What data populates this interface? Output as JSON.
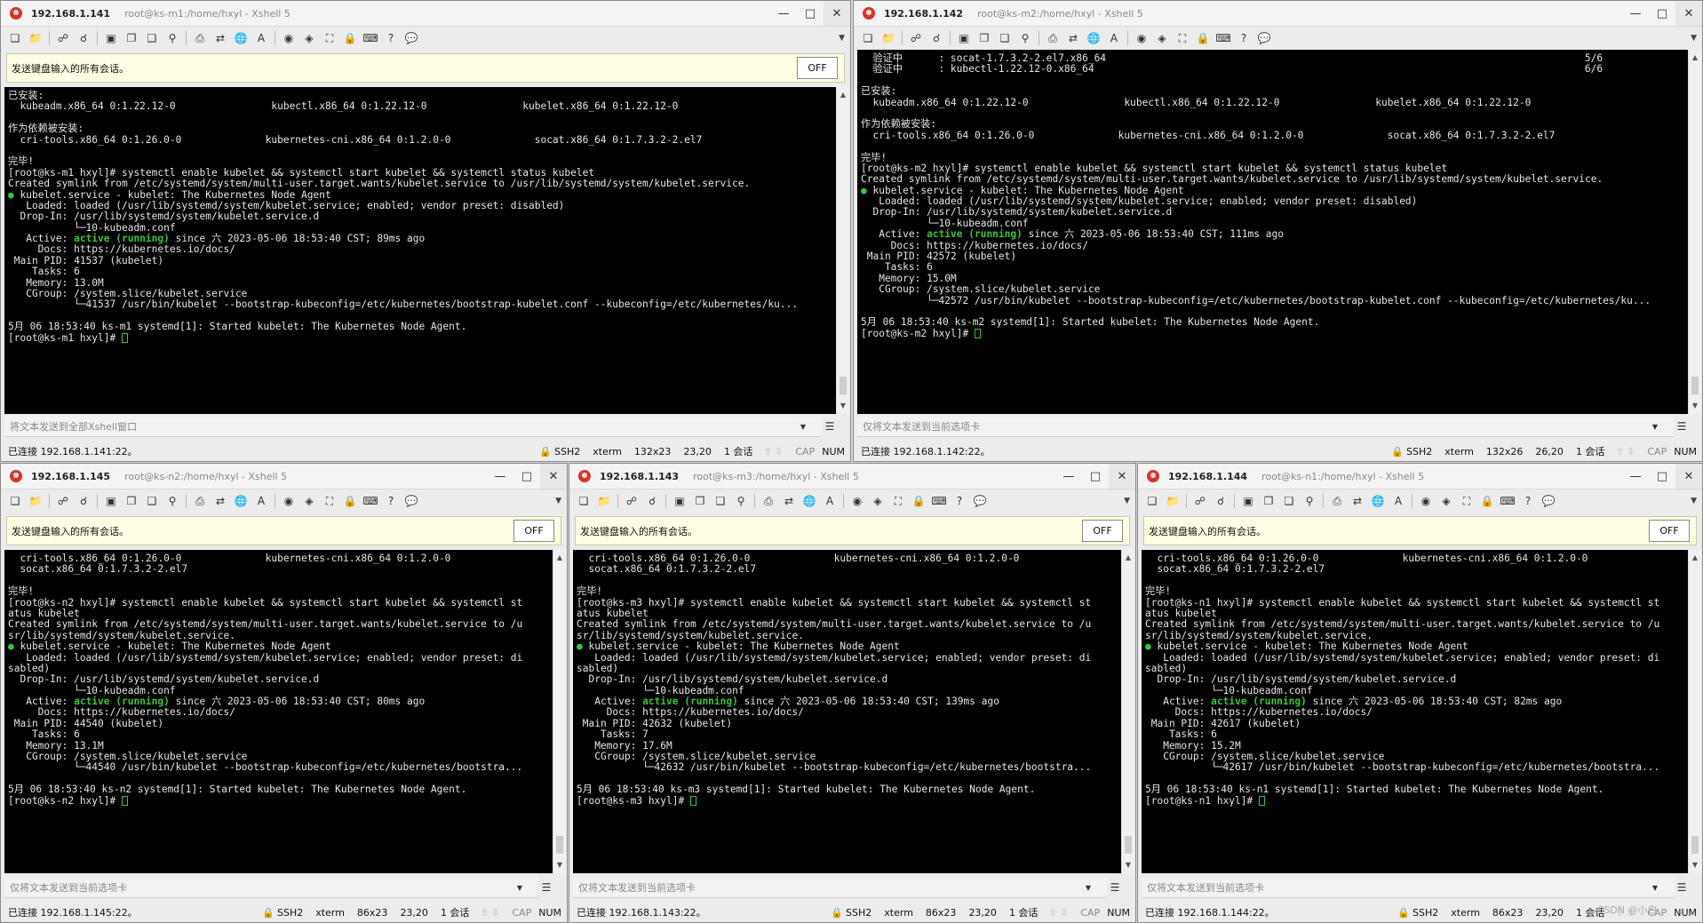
{
  "send_all_label": "发送键盘输入的所有会话。",
  "off_label": "OFF",
  "windows": [
    {
      "ip": "192.168.1.141",
      "path": "root@ks-m1:/home/hxyl - Xshell 5",
      "input_placeholder": "将文本发送到全部Xshell窗口",
      "status": {
        "conn": "已连接 192.168.1.141:22。",
        "ssh": "SSH2",
        "term": "xterm",
        "size": "132x23",
        "pos": "23,20",
        "sessions": "1 会话",
        "cap": "CAP",
        "num": "NUM"
      },
      "lines": [
        "已安装:",
        "  kubeadm.x86_64 0:1.22.12-0                kubectl.x86_64 0:1.22.12-0                kubelet.x86_64 0:1.22.12-0",
        "",
        "作为依赖被安装:",
        "  cri-tools.x86_64 0:1.26.0-0              kubernetes-cni.x86_64 0:1.2.0-0              socat.x86_64 0:1.7.3.2-2.el7",
        "",
        "完毕!",
        "[root@ks-m1 hxyl]# systemctl enable kubelet && systemctl start kubelet && systemctl status kubelet",
        "Created symlink from /etc/systemd/system/multi-user.target.wants/kubelet.service to /usr/lib/systemd/system/kubelet.service.",
        "● kubelet.service - kubelet: The Kubernetes Node Agent",
        "   Loaded: loaded (/usr/lib/systemd/system/kubelet.service; enabled; vendor preset: disabled)",
        "  Drop-In: /usr/lib/systemd/system/kubelet.service.d",
        "           └─10-kubeadm.conf",
        "   Active: active (running) since 六 2023-05-06 18:53:40 CST; 89ms ago",
        "     Docs: https://kubernetes.io/docs/",
        " Main PID: 41537 (kubelet)",
        "    Tasks: 6",
        "   Memory: 13.0M",
        "   CGroup: /system.slice/kubelet.service",
        "           └─41537 /usr/bin/kubelet --bootstrap-kubeconfig=/etc/kubernetes/bootstrap-kubelet.conf --kubeconfig=/etc/kubernetes/ku...",
        "",
        "5月 06 18:53:40 ks-m1 systemd[1]: Started kubelet: The Kubernetes Node Agent.",
        "[root@ks-m1 hxyl]# "
      ]
    },
    {
      "ip": "192.168.1.142",
      "path": "root@ks-m2:/home/hxyl - Xshell 5",
      "input_placeholder": "仅将文本发送到当前选项卡",
      "status": {
        "conn": "已连接 192.168.1.142:22。",
        "ssh": "SSH2",
        "term": "xterm",
        "size": "132x26",
        "pos": "26,20",
        "sessions": "1 会话",
        "cap": "CAP",
        "num": "NUM"
      },
      "lines": [
        "  验证中      : socat-1.7.3.2-2.el7.x86_64                                                                                5/6",
        "  验证中      : kubectl-1.22.12-0.x86_64                                                                                  6/6",
        "",
        "已安装:",
        "  kubeadm.x86_64 0:1.22.12-0                kubectl.x86_64 0:1.22.12-0                kubelet.x86_64 0:1.22.12-0",
        "",
        "作为依赖被安装:",
        "  cri-tools.x86_64 0:1.26.0-0              kubernetes-cni.x86_64 0:1.2.0-0              socat.x86_64 0:1.7.3.2-2.el7",
        "",
        "完毕!",
        "[root@ks-m2 hxyl]# systemctl enable kubelet && systemctl start kubelet && systemctl status kubelet",
        "Created symlink from /etc/systemd/system/multi-user.target.wants/kubelet.service to /usr/lib/systemd/system/kubelet.service.",
        "● kubelet.service - kubelet: The Kubernetes Node Agent",
        "   Loaded: loaded (/usr/lib/systemd/system/kubelet.service; enabled; vendor preset: disabled)",
        "  Drop-In: /usr/lib/systemd/system/kubelet.service.d",
        "           └─10-kubeadm.conf",
        "   Active: active (running) since 六 2023-05-06 18:53:40 CST; 111ms ago",
        "     Docs: https://kubernetes.io/docs/",
        " Main PID: 42572 (kubelet)",
        "    Tasks: 6",
        "   Memory: 15.0M",
        "   CGroup: /system.slice/kubelet.service",
        "           └─42572 /usr/bin/kubelet --bootstrap-kubeconfig=/etc/kubernetes/bootstrap-kubelet.conf --kubeconfig=/etc/kubernetes/ku...",
        "",
        "5月 06 18:53:40 ks-m2 systemd[1]: Started kubelet: The Kubernetes Node Agent.",
        "[root@ks-m2 hxyl]# "
      ]
    },
    {
      "ip": "192.168.1.145",
      "path": "root@ks-n2:/home/hxyl - Xshell 5",
      "input_placeholder": "仅将文本发送到当前选项卡",
      "status": {
        "conn": "已连接 192.168.1.145:22。",
        "ssh": "SSH2",
        "term": "xterm",
        "size": "86x23",
        "pos": "23,20",
        "sessions": "1 会话",
        "cap": "CAP",
        "num": "NUM"
      },
      "lines": [
        "  cri-tools.x86_64 0:1.26.0-0              kubernetes-cni.x86_64 0:1.2.0-0",
        "  socat.x86_64 0:1.7.3.2-2.el7",
        "",
        "完毕!",
        "[root@ks-n2 hxyl]# systemctl enable kubelet && systemctl start kubelet && systemctl st",
        "atus kubelet",
        "Created symlink from /etc/systemd/system/multi-user.target.wants/kubelet.service to /u",
        "sr/lib/systemd/system/kubelet.service.",
        "● kubelet.service - kubelet: The Kubernetes Node Agent",
        "   Loaded: loaded (/usr/lib/systemd/system/kubelet.service; enabled; vendor preset: di",
        "sabled)",
        "  Drop-In: /usr/lib/systemd/system/kubelet.service.d",
        "           └─10-kubeadm.conf",
        "   Active: active (running) since 六 2023-05-06 18:53:40 CST; 80ms ago",
        "     Docs: https://kubernetes.io/docs/",
        " Main PID: 44540 (kubelet)",
        "    Tasks: 6",
        "   Memory: 13.1M",
        "   CGroup: /system.slice/kubelet.service",
        "           └─44540 /usr/bin/kubelet --bootstrap-kubeconfig=/etc/kubernetes/bootstra...",
        "",
        "5月 06 18:53:40 ks-n2 systemd[1]: Started kubelet: The Kubernetes Node Agent.",
        "[root@ks-n2 hxyl]# "
      ]
    },
    {
      "ip": "192.168.1.143",
      "path": "root@ks-m3:/home/hxyl - Xshell 5",
      "input_placeholder": "仅将文本发送到当前选项卡",
      "status": {
        "conn": "已连接 192.168.1.143:22。",
        "ssh": "SSH2",
        "term": "xterm",
        "size": "86x23",
        "pos": "23,20",
        "sessions": "1 会话",
        "cap": "CAP",
        "num": "NUM"
      },
      "lines": [
        "  cri-tools.x86_64 0:1.26.0-0              kubernetes-cni.x86_64 0:1.2.0-0",
        "  socat.x86_64 0:1.7.3.2-2.el7",
        "",
        "完毕!",
        "[root@ks-m3 hxyl]# systemctl enable kubelet && systemctl start kubelet && systemctl st",
        "atus kubelet",
        "Created symlink from /etc/systemd/system/multi-user.target.wants/kubelet.service to /u",
        "sr/lib/systemd/system/kubelet.service.",
        "● kubelet.service - kubelet: The Kubernetes Node Agent",
        "   Loaded: loaded (/usr/lib/systemd/system/kubelet.service; enabled; vendor preset: di",
        "sabled)",
        "  Drop-In: /usr/lib/systemd/system/kubelet.service.d",
        "           └─10-kubeadm.conf",
        "   Active: active (running) since 六 2023-05-06 18:53:40 CST; 139ms ago",
        "     Docs: https://kubernetes.io/docs/",
        " Main PID: 42632 (kubelet)",
        "    Tasks: 7",
        "   Memory: 17.6M",
        "   CGroup: /system.slice/kubelet.service",
        "           └─42632 /usr/bin/kubelet --bootstrap-kubeconfig=/etc/kubernetes/bootstra...",
        "",
        "5月 06 18:53:40 ks-m3 systemd[1]: Started kubelet: The Kubernetes Node Agent.",
        "[root@ks-m3 hxyl]# "
      ]
    },
    {
      "ip": "192.168.1.144",
      "path": "root@ks-n1:/home/hxyl - Xshell 5",
      "input_placeholder": "仅将文本发送到当前选项卡",
      "status": {
        "conn": "已连接 192.168.1.144:22。",
        "ssh": "SSH2",
        "term": "xterm",
        "size": "86x23",
        "pos": "23,20",
        "sessions": "1 会话",
        "cap": "CAP",
        "num": "NUM"
      },
      "lines": [
        "  cri-tools.x86_64 0:1.26.0-0              kubernetes-cni.x86_64 0:1.2.0-0",
        "  socat.x86_64 0:1.7.3.2-2.el7",
        "",
        "完毕!",
        "[root@ks-n1 hxyl]# systemctl enable kubelet && systemctl start kubelet && systemctl st",
        "atus kubelet",
        "Created symlink from /etc/systemd/system/multi-user.target.wants/kubelet.service to /u",
        "sr/lib/systemd/system/kubelet.service.",
        "● kubelet.service - kubelet: The Kubernetes Node Agent",
        "   Loaded: loaded (/usr/lib/systemd/system/kubelet.service; enabled; vendor preset: di",
        "sabled)",
        "  Drop-In: /usr/lib/systemd/system/kubelet.service.d",
        "           └─10-kubeadm.conf",
        "   Active: active (running) since 六 2023-05-06 18:53:40 CST; 82ms ago",
        "     Docs: https://kubernetes.io/docs/",
        " Main PID: 42617 (kubelet)",
        "    Tasks: 6",
        "   Memory: 15.2M",
        "   CGroup: /system.slice/kubelet.service",
        "           └─42617 /usr/bin/kubelet --bootstrap-kubeconfig=/etc/kubernetes/bootstra...",
        "",
        "5月 06 18:53:40 ks-n1 systemd[1]: Started kubelet: The Kubernetes Node Agent.",
        "[root@ks-n1 hxyl]# "
      ]
    }
  ],
  "watermark": "CSDN @小白..."
}
